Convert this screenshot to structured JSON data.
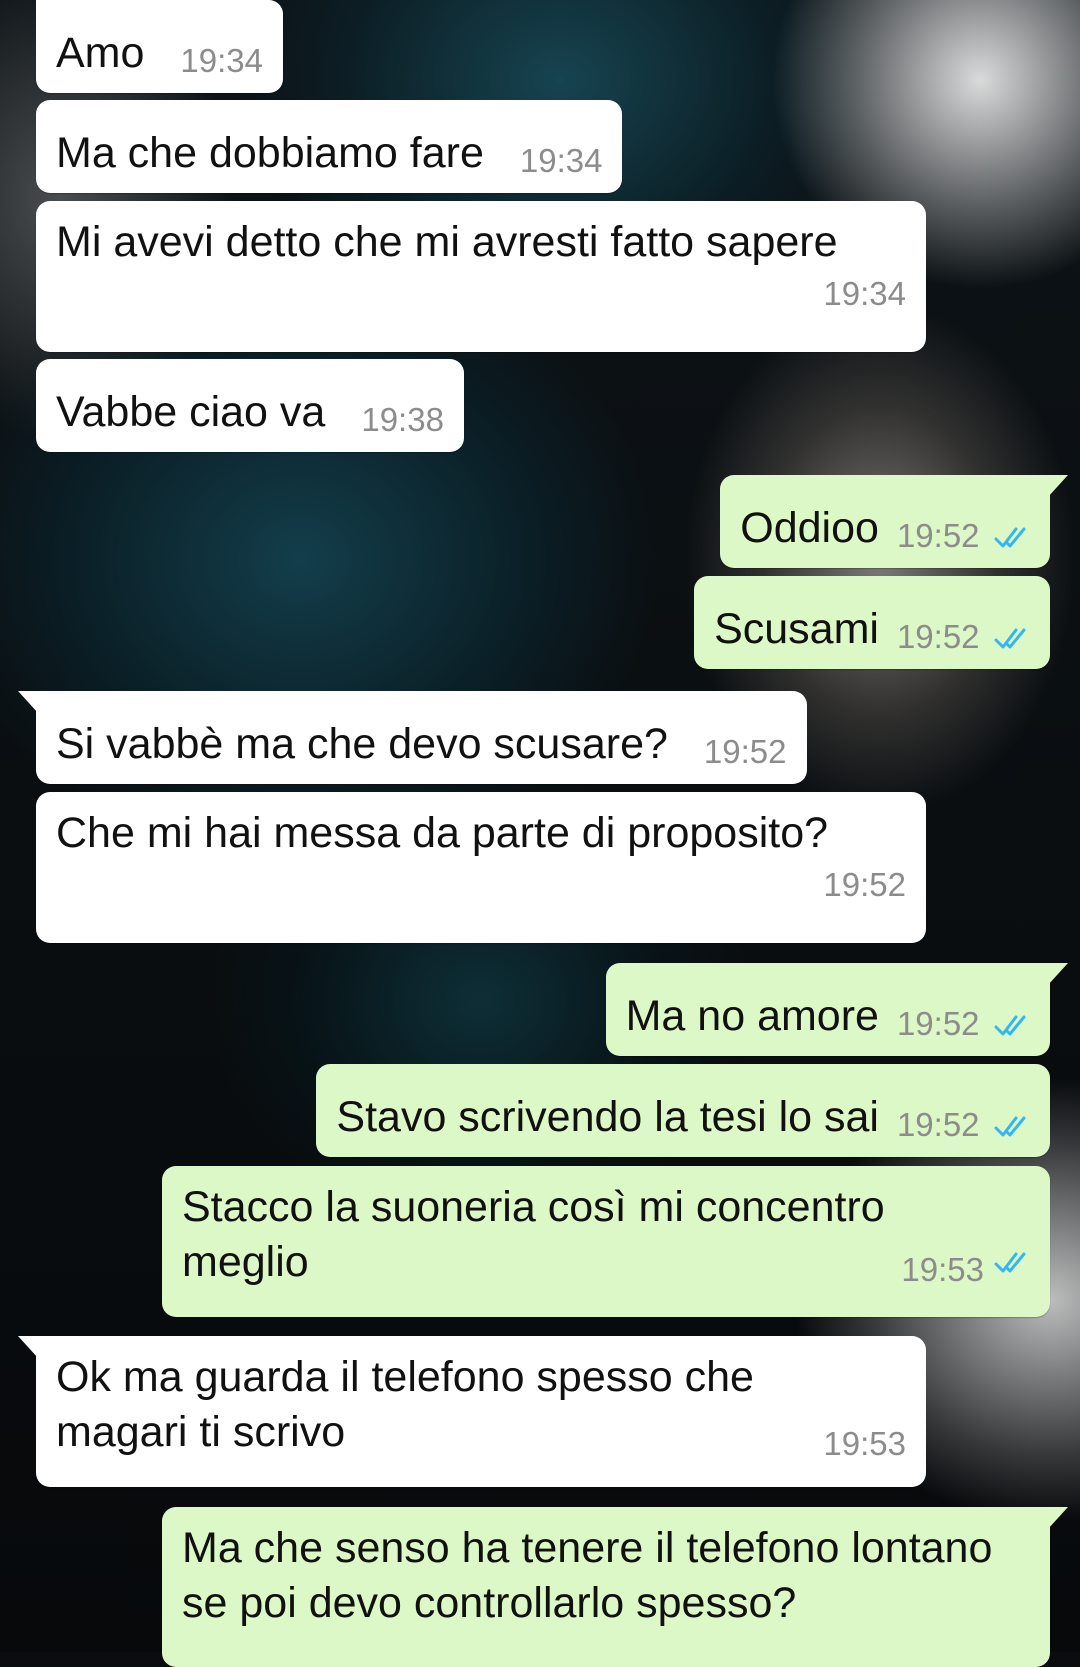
{
  "colors": {
    "incoming_bubble": "#ffffff",
    "outgoing_bubble": "#dcf8c6",
    "timestamp": "#8c8c8c",
    "read_ticks": "#34b7f1"
  },
  "messages": [
    {
      "direction": "in",
      "text": "Amo",
      "time": "19:34"
    },
    {
      "direction": "in",
      "text": "Ma che dobbiamo fare",
      "time": "19:34"
    },
    {
      "direction": "in",
      "text": "Mi avevi detto che mi avresti fatto sapere",
      "time": "19:34"
    },
    {
      "direction": "in",
      "text": "Vabbe ciao va",
      "time": "19:38"
    },
    {
      "direction": "out",
      "text": "Oddioo",
      "time": "19:52",
      "status": "read"
    },
    {
      "direction": "out",
      "text": "Scusami",
      "time": "19:52",
      "status": "read"
    },
    {
      "direction": "in",
      "text": "Si vabbè ma che devo scusare?",
      "time": "19:52"
    },
    {
      "direction": "in",
      "text": "Che mi hai messa da parte di proposito?",
      "time": "19:52"
    },
    {
      "direction": "out",
      "text": "Ma no amore",
      "time": "19:52",
      "status": "read"
    },
    {
      "direction": "out",
      "text": "Stavo scrivendo la tesi lo sai",
      "time": "19:52",
      "status": "read"
    },
    {
      "direction": "out",
      "text": "Stacco la suoneria così mi concentro meglio",
      "time": "19:53",
      "status": "read"
    },
    {
      "direction": "in",
      "text": "Ok ma guarda il telefono spesso che magari ti scrivo",
      "time": "19:53"
    },
    {
      "direction": "out",
      "text": "Ma che senso ha tenere il telefono lontano se poi devo controllarlo spesso?",
      "time": "",
      "status": ""
    }
  ]
}
